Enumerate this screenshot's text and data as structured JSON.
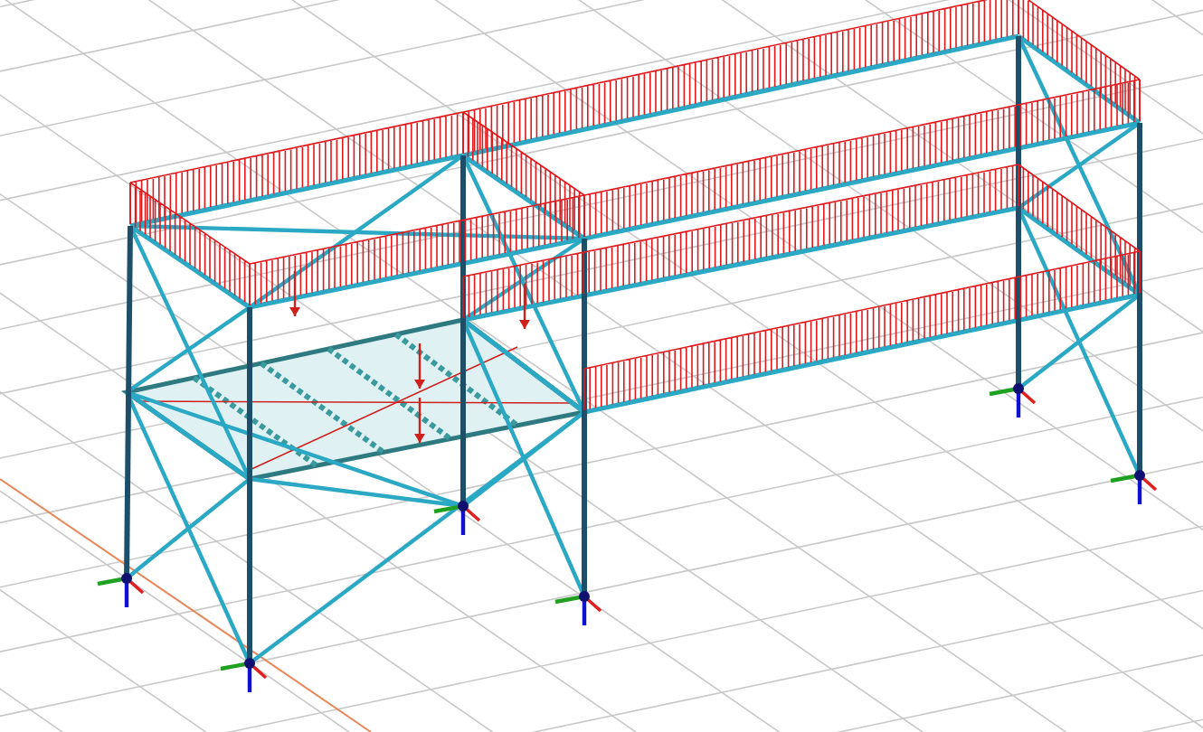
{
  "viewport": {
    "show_grid": true,
    "show_loads": true,
    "show_supports": true,
    "show_platform": true
  }
}
